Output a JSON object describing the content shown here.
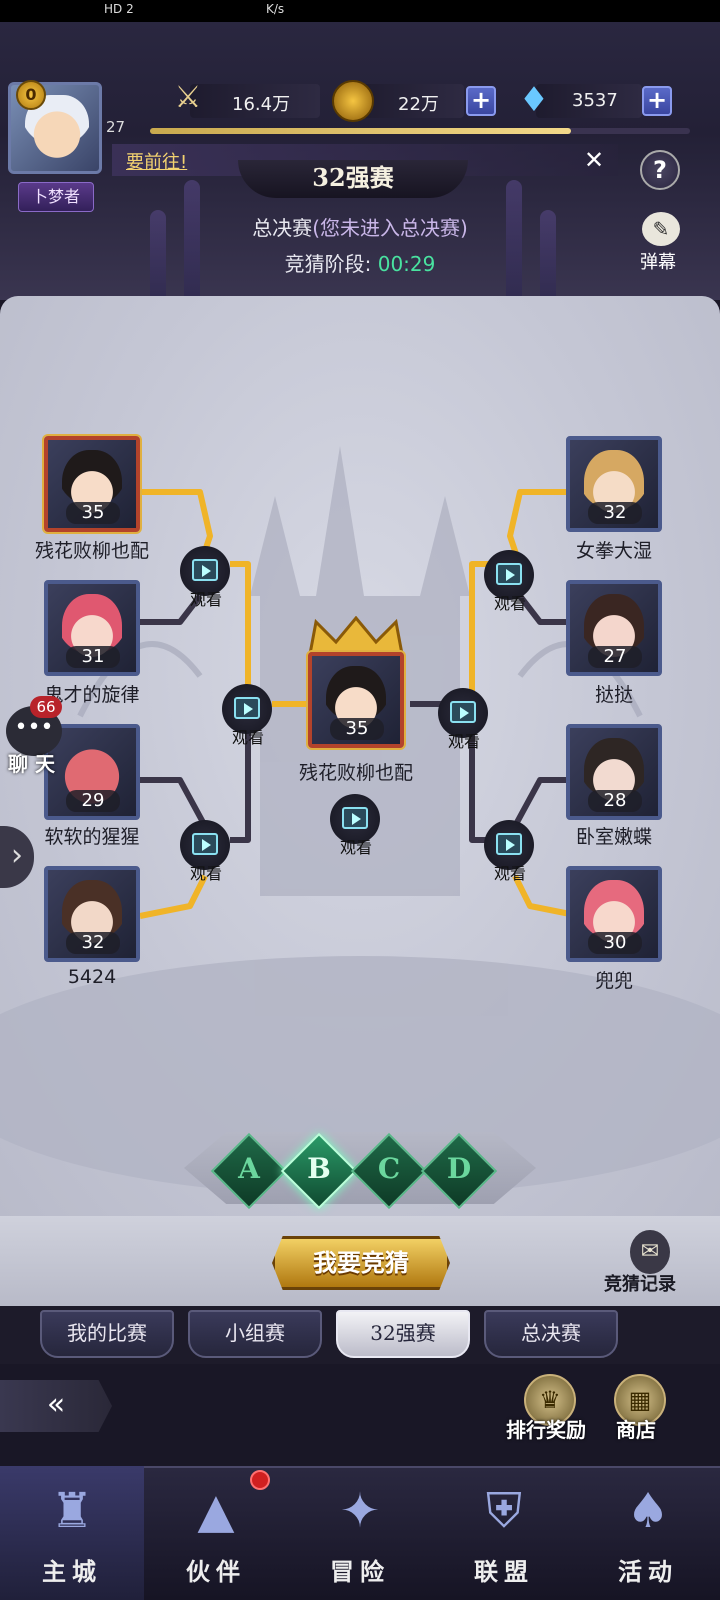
{
  "status_bar": {
    "left": "HD 2",
    "speed": "K/s"
  },
  "player": {
    "avatar_level": "0",
    "level": "27",
    "title": "卜梦者",
    "xp_fraction": 0.78
  },
  "resources": {
    "power": "16.4万",
    "gold": "22万",
    "gems": "3537"
  },
  "notice": {
    "text": "要前往!"
  },
  "stage": {
    "title": "32强赛",
    "final_label": "总决赛",
    "final_sub": "(您未进入总决赛)",
    "guess_phase_label": "竞猜阶段:",
    "guess_timer": "00:29"
  },
  "danmu": {
    "label": "弹幕"
  },
  "bracket": {
    "watch_label": "观看",
    "left": [
      {
        "name": "残花败柳也配",
        "level": "35"
      },
      {
        "name": "鬼才的旋律",
        "level": "31"
      },
      {
        "name": "软软的猩猩",
        "level": "29"
      },
      {
        "name": "5424",
        "level": "32"
      }
    ],
    "right": [
      {
        "name": "女拳大湿",
        "level": "32"
      },
      {
        "name": "挞挞",
        "level": "27"
      },
      {
        "name": "卧室嫩蝶",
        "level": "28"
      },
      {
        "name": "兜兜",
        "level": "30"
      }
    ],
    "champion": {
      "name": "残花败柳也配",
      "level": "35"
    }
  },
  "chat": {
    "label": "聊 天",
    "badge": "66"
  },
  "groups": [
    "A",
    "B",
    "C",
    "D"
  ],
  "selected_group": "B",
  "guess": {
    "button": "我要竞猜",
    "record": "竞猜记录"
  },
  "tabs": [
    "我的比赛",
    "小组赛",
    "32强赛",
    "总决赛"
  ],
  "active_tab": "32强赛",
  "features": {
    "ranking_rewards": "排行奖励",
    "shop": "商店"
  },
  "nav": [
    {
      "label": "主城",
      "icon": "castle-icon"
    },
    {
      "label": "伙伴",
      "icon": "witch-hat-icon"
    },
    {
      "label": "冒险",
      "icon": "compass-icon"
    },
    {
      "label": "联盟",
      "icon": "shield-icon"
    },
    {
      "label": "活动",
      "icon": "cards-icon"
    }
  ],
  "colors": {
    "accent_gold": "#f3d98a",
    "timer_green": "#49e2a0",
    "group_green": "#1f6a48",
    "notice_yellow": "#f3d270"
  }
}
